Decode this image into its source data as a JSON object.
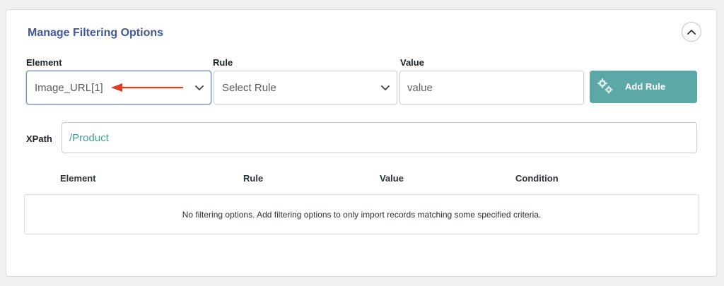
{
  "panel": {
    "title": "Manage Filtering Options",
    "collapse_icon": "chevron-up-icon"
  },
  "form": {
    "element_label": "Element",
    "rule_label": "Rule",
    "value_label": "Value",
    "element_selected": "Image_URL[1]",
    "rule_selected": "Select Rule",
    "value_placeholder": "value",
    "add_rule_label": "Add Rule",
    "add_rule_icon": "gears-icon",
    "accent_color": "#5ba8a6"
  },
  "annotation": {
    "arrow_color": "#e03a22"
  },
  "xpath": {
    "label": "XPath",
    "value": "/Product"
  },
  "table": {
    "columns": [
      "Element",
      "Rule",
      "Value",
      "Condition"
    ],
    "empty_message": "No filtering options. Add filtering options to only import records matching some specified criteria."
  }
}
